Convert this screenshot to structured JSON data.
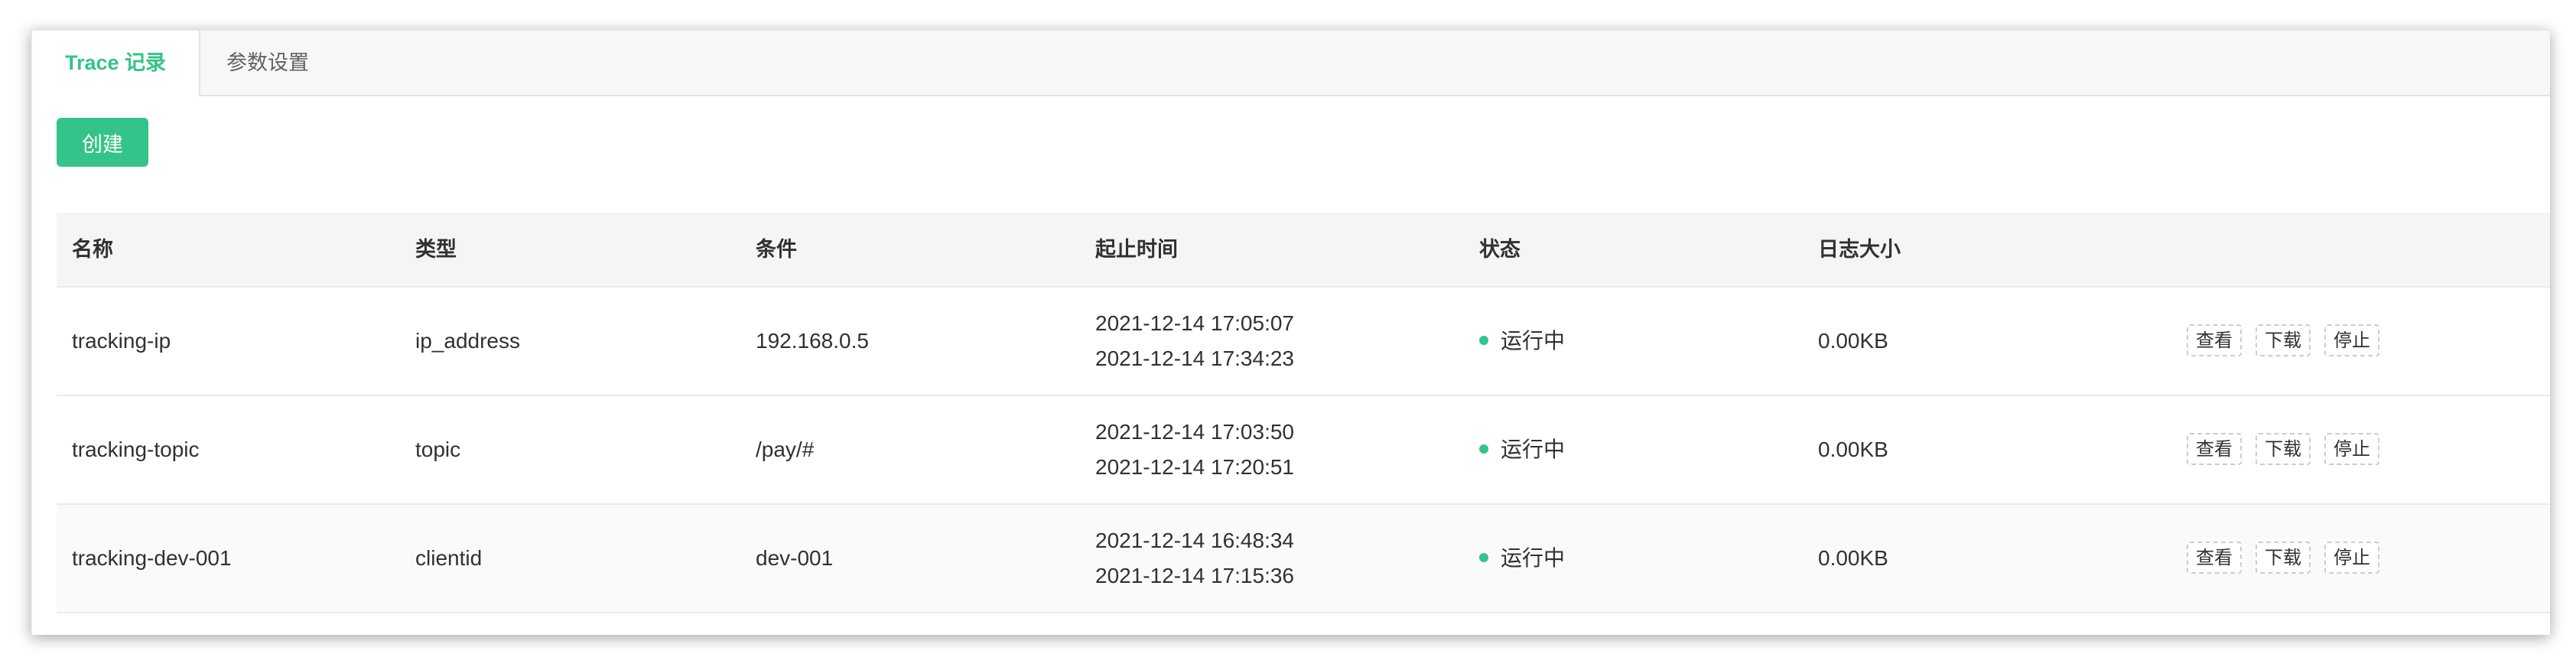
{
  "tabs": [
    {
      "label": "Trace 记录",
      "active": true
    },
    {
      "label": "参数设置",
      "active": false
    }
  ],
  "toolbar": {
    "create_label": "创建"
  },
  "table": {
    "headers": [
      "名称",
      "类型",
      "条件",
      "起止时间",
      "状态",
      "日志大小"
    ],
    "rows": [
      {
        "name": "tracking-ip",
        "type": "ip_address",
        "condition": "192.168.0.5",
        "start": "2021-12-14 17:05:07",
        "end": "2021-12-14 17:34:23",
        "status": "运行中",
        "size": "0.00KB"
      },
      {
        "name": "tracking-topic",
        "type": "topic",
        "condition": "/pay/#",
        "start": "2021-12-14 17:03:50",
        "end": "2021-12-14 17:20:51",
        "status": "运行中",
        "size": "0.00KB"
      },
      {
        "name": "tracking-dev-001",
        "type": "clientid",
        "condition": "dev-001",
        "start": "2021-12-14 16:48:34",
        "end": "2021-12-14 17:15:36",
        "status": "运行中",
        "size": "0.00KB"
      }
    ],
    "actions": {
      "view": "查看",
      "download": "下载",
      "stop": "停止"
    }
  },
  "colors": {
    "accent": "#34c388",
    "header_bg": "#f5f5f5",
    "text": "#303133"
  }
}
